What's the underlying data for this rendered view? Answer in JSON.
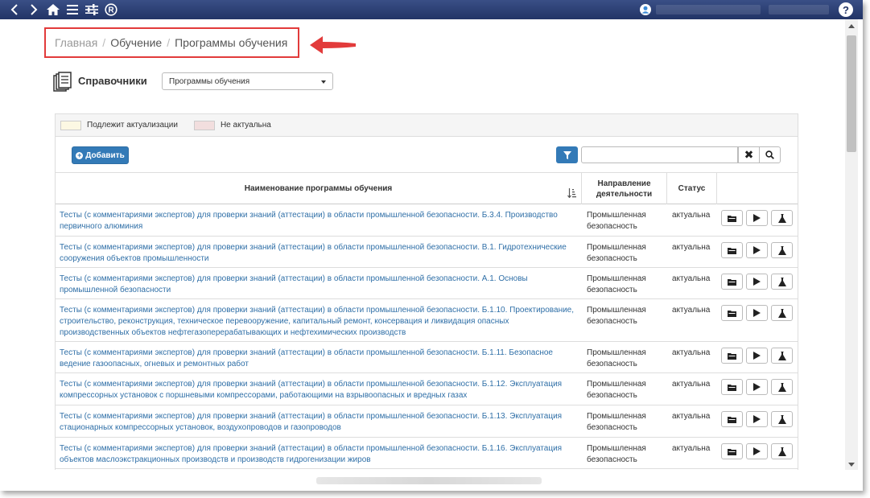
{
  "breadcrumb": {
    "home": "Главная",
    "section": "Обучение",
    "current": "Программы обучения",
    "separator": "/"
  },
  "header": {
    "title": "Справочники",
    "select_value": "Программы обучения"
  },
  "legend": {
    "items": [
      {
        "label": "Подлежит актуализации",
        "color": "#fcf8e3"
      },
      {
        "label": "Не актуальна",
        "color": "#f2dede"
      }
    ]
  },
  "toolbar": {
    "add_label": "Добавить",
    "search_value": "",
    "clear_symbol": "✖"
  },
  "table": {
    "headers": {
      "name": "Наименование программы обучения",
      "direction_line1": "Направление",
      "direction_line2": "деятельности",
      "status": "Статус"
    },
    "rows": [
      {
        "name_line1": "Тесты (с комментариями экспертов) для проверки знаний (аттестации) в области промышленной безопасности. Б.3.4. Производство",
        "name_line2": "первичного алюминия",
        "name_line3": "",
        "direction_line1": "Промышленная",
        "direction_line2": "безопасность",
        "status": "актуальна"
      },
      {
        "name_line1": "Тесты (с комментариями экспертов) для проверки знаний (аттестации) в области промышленной безопасности. В.1. Гидротехнические",
        "name_line2": "сооружения объектов промышленности",
        "name_line3": "",
        "direction_line1": "Промышленная",
        "direction_line2": "безопасность",
        "status": "актуальна"
      },
      {
        "name_line1": "Тесты (с комментариями экспертов) для проверки знаний (аттестации) в области промышленной безопасности. А.1. Основы",
        "name_line2": "промышленной безопасности",
        "name_line3": "",
        "direction_line1": "Промышленная",
        "direction_line2": "безопасность",
        "status": "актуальна"
      },
      {
        "name_line1": "Тесты (с комментариями экспертов) для проверки знаний (аттестации) в области промышленной безопасности. Б.1.10. Проектирование,",
        "name_line2": "строительство, реконструкция, техническое перевооружение, капитальный ремонт, консервация и ликвидация опасных",
        "name_line3": "производственных объектов нефтегазоперерабатывающих и нефтехимических производств",
        "direction_line1": "Промышленная",
        "direction_line2": "безопасность",
        "status": "актуальна"
      },
      {
        "name_line1": "Тесты (с комментариями экспертов) для проверки знаний (аттестации) в области промышленной безопасности. Б.1.11. Безопасное",
        "name_line2": "ведение газоопасных, огневых и ремонтных работ",
        "name_line3": "",
        "direction_line1": "Промышленная",
        "direction_line2": "безопасность",
        "status": "актуальна"
      },
      {
        "name_line1": "Тесты (с комментариями экспертов) для проверки знаний (аттестации) в области промышленной безопасности. Б.1.12. Эксплуатация",
        "name_line2": "компрессорных установок с поршневыми компрессорами, работающими на взрывоопасных и вредных газах",
        "name_line3": "",
        "direction_line1": "Промышленная",
        "direction_line2": "безопасность",
        "status": "актуальна"
      },
      {
        "name_line1": "Тесты (с комментариями экспертов) для проверки знаний (аттестации) в области промышленной безопасности. Б.1.13. Эксплуатация",
        "name_line2": "стационарных компрессорных установок, воздухопроводов и газопроводов",
        "name_line3": "",
        "direction_line1": "Промышленная",
        "direction_line2": "безопасность",
        "status": "актуальна"
      },
      {
        "name_line1": "Тесты (с комментариями экспертов) для проверки знаний (аттестации) в области промышленной безопасности. Б.1.16. Эксплуатация",
        "name_line2": "объектов маслоэкстракционных производств и производств гидрогенизации жиров",
        "name_line3": "",
        "direction_line1": "Промышленная",
        "direction_line2": "безопасность",
        "status": "актуальна"
      }
    ]
  },
  "colors": {
    "topbar": "#2b3d73",
    "accent": "#337ab7",
    "link": "#2f6fa7",
    "highlight": "#e23b3b"
  },
  "icons": [
    "back-icon",
    "forward-icon",
    "home-icon",
    "menu-icon",
    "settings-icon",
    "registered-icon",
    "user-icon",
    "help-icon",
    "reference-books-icon",
    "filter-icon",
    "search-icon",
    "folder-icon",
    "play-icon",
    "flask-icon",
    "sort-icon"
  ]
}
